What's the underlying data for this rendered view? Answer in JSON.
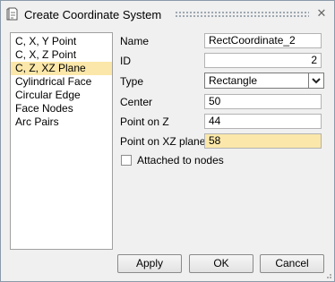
{
  "window": {
    "title": "Create Coordinate System",
    "close_glyph": "✕"
  },
  "methods": [
    {
      "label": "C, X, Y Point",
      "selected": false
    },
    {
      "label": "C, X, Z Point",
      "selected": false
    },
    {
      "label": "C, Z, XZ Plane",
      "selected": true
    },
    {
      "label": "Cylindrical Face",
      "selected": false
    },
    {
      "label": "Circular Edge",
      "selected": false
    },
    {
      "label": "Face Nodes",
      "selected": false
    },
    {
      "label": "Arc Pairs",
      "selected": false
    }
  ],
  "form": {
    "name_label": "Name",
    "name_value": "RectCoordinate_2",
    "id_label": "ID",
    "id_value": "2",
    "type_label": "Type",
    "type_value": "Rectangle",
    "center_label": "Center",
    "center_value": "50",
    "point_z_label": "Point on Z",
    "point_z_value": "44",
    "point_xz_label": "Point on XZ plane",
    "point_xz_value": "58",
    "attached_label": "Attached to nodes",
    "attached_checked": false
  },
  "buttons": {
    "apply": "Apply",
    "ok": "OK",
    "cancel": "Cancel"
  },
  "colors": {
    "selection": "#fbe7a9",
    "dialog_bg": "#f0f0f0"
  },
  "icons": {
    "title": "document-icon",
    "close": "close-icon",
    "dropdown": "chevron-down-icon"
  }
}
